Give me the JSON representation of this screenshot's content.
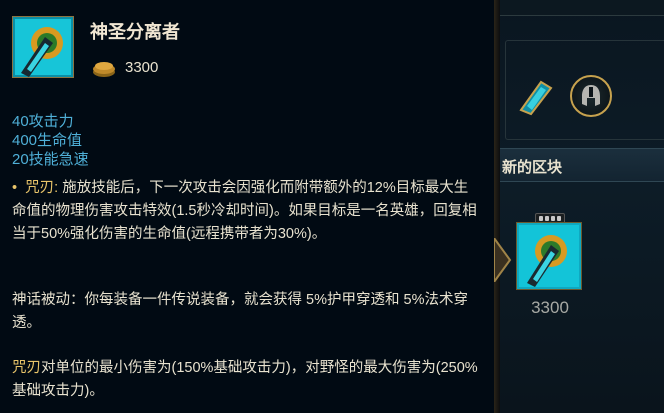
{
  "tooltip": {
    "item_name": "神圣分离者",
    "price": "3300",
    "stats": [
      "40攻击力",
      "400生命值",
      "20技能急速"
    ],
    "passive_bullet": "•",
    "passive_name": "咒刃:",
    "passive_text": "施放技能后，下一次攻击会因强化而附带额外的12%目标最大生命值的物理伤害攻击特效(1.5秒冷却时间)。如果目标是一名英雄，回复相当于50%强化伤害的生命值(远程携带者为30%)。",
    "mythic_text": "神话被动：你每装备一件传说装备，就会获得 5%护甲穿透和 5%法术穿透。",
    "note_keyword": "咒刃",
    "note_text": "对单位的最小伤害为(150%基础攻击力)，对野怪的最大伤害为(250%基础攻击力)。"
  },
  "shop": {
    "section_header": "新的区块",
    "item_price": "3300",
    "helm_icon": "helmet-icon",
    "grid_icon": "build-path-grid-icon"
  },
  "colors": {
    "stat_blue": "#4fb0d8",
    "keyword_gold": "#e8c46a",
    "border_gold": "#8b7442",
    "tooltip_bg": "#010a13"
  }
}
